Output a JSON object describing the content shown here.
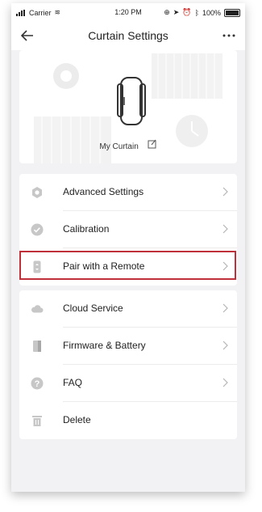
{
  "status": {
    "carrier": "Carrier",
    "time": "1:20 PM",
    "battery": "100%"
  },
  "nav": {
    "title": "Curtain Settings",
    "back_icon": "arrow-left-icon",
    "more_icon": "more-dots-icon"
  },
  "device": {
    "name": "My Curtain",
    "edit_icon": "edit-icon"
  },
  "group1": [
    {
      "label": "Advanced Settings",
      "icon": "gear-icon"
    },
    {
      "label": "Calibration",
      "icon": "check-icon"
    },
    {
      "label": "Pair with a Remote",
      "icon": "remote-icon",
      "highlighted": true
    }
  ],
  "group2": [
    {
      "label": "Cloud Service",
      "icon": "cloud-icon"
    },
    {
      "label": "Firmware & Battery",
      "icon": "firmware-icon"
    },
    {
      "label": "FAQ",
      "icon": "question-icon"
    },
    {
      "label": "Delete",
      "icon": "trash-icon"
    }
  ],
  "colors": {
    "highlight": "#c0303a",
    "icon_gray": "#bdbdbd"
  }
}
